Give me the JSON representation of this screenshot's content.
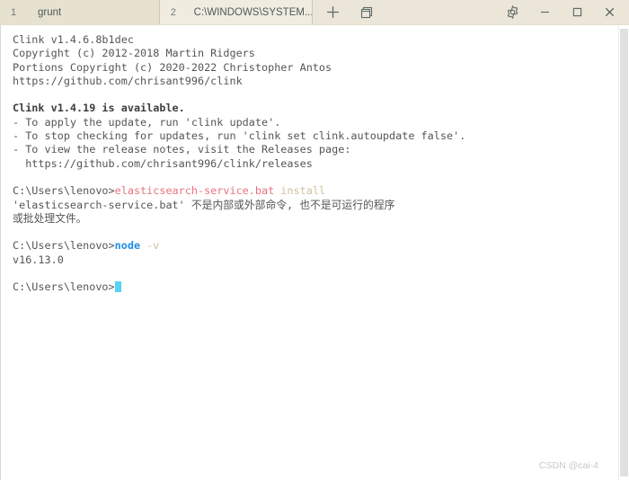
{
  "window": {
    "tabbar": {
      "background_color": "#ebe6d7",
      "tabs": [
        {
          "number": "1",
          "title": "grunt",
          "active": false
        },
        {
          "number": "2",
          "title": "C:\\WINDOWS\\SYSTEM...",
          "active": true
        }
      ],
      "actions": [
        {
          "name": "new-tab-button",
          "label": "+"
        },
        {
          "name": "duplicate-pane-button",
          "label": ""
        }
      ],
      "controls": [
        {
          "name": "settings-button",
          "label": ""
        },
        {
          "name": "minimize-button",
          "label": ""
        },
        {
          "name": "maximize-button",
          "label": ""
        },
        {
          "name": "close-button",
          "label": ""
        }
      ]
    },
    "terminal": {
      "background_color": "#ffffff",
      "foreground_color": "#555555",
      "cursor_color": "#55d4f5",
      "lines": [
        {
          "id": "l01",
          "text": "Clink v1.4.6.8b1dec"
        },
        {
          "id": "l02",
          "text": "Copyright (c) 2012-2018 Martin Ridgers"
        },
        {
          "id": "l03",
          "text": "Portions Copyright (c) 2020-2022 Christopher Antos"
        },
        {
          "id": "l04",
          "text": "https://github.com/chrisant996/clink"
        },
        {
          "id": "l05",
          "text": ""
        },
        {
          "id": "l06",
          "text": "Clink v1.4.19 is available."
        },
        {
          "id": "l07",
          "text": "- To apply the update, run 'clink update'."
        },
        {
          "id": "l08",
          "text": "- To stop checking for updates, run 'clink set clink.autoupdate false'."
        },
        {
          "id": "l09",
          "text": "- To view the release notes, visit the Releases page:"
        },
        {
          "id": "l10",
          "text": "  https://github.com/chrisant996/clink/releases"
        },
        {
          "id": "l11",
          "text": ""
        },
        {
          "id": "l12_prompt",
          "text": "C:\\Users\\lenovo>"
        },
        {
          "id": "l12_cmd",
          "text": "elasticsearch-service.bat"
        },
        {
          "id": "l12_arg",
          "text": " install"
        },
        {
          "id": "l13",
          "text": "'elasticsearch-service.bat' 不是内部或外部命令, 也不是可运行的程序"
        },
        {
          "id": "l14",
          "text": "或批处理文件。"
        },
        {
          "id": "l15",
          "text": ""
        },
        {
          "id": "l16_prompt",
          "text": "C:\\Users\\lenovo>"
        },
        {
          "id": "l16_cmd",
          "text": "node"
        },
        {
          "id": "l16_arg",
          "text": " -v"
        },
        {
          "id": "l17",
          "text": "v16.13.0"
        },
        {
          "id": "l18",
          "text": ""
        },
        {
          "id": "l19_prompt",
          "text": "C:\\Users\\lenovo>"
        }
      ]
    },
    "scrollbar": {
      "name": "vertical-scrollbar"
    },
    "watermark": {
      "text": "CSDN @cai-4"
    }
  }
}
